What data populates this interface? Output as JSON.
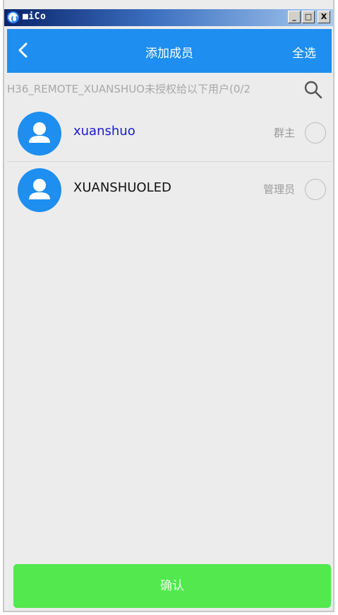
{
  "window": {
    "title": "■iCo",
    "minimize_label": "_",
    "maximize_label": "□",
    "close_label": "X"
  },
  "header": {
    "title": "添加成员",
    "select_all_label": "全选"
  },
  "subtitle": {
    "text": "H36_REMOTE_XUANSHUO未授权给以下用户(0/2"
  },
  "members": [
    {
      "name": "xuanshuo",
      "role": "群主",
      "name_color": "#1a1ad6"
    },
    {
      "name": "XUANSHUOLED",
      "role": "管理员",
      "name_color": "#111111"
    }
  ],
  "footer": {
    "confirm_label": "确认"
  },
  "colors": {
    "accent": "#1e8ef0",
    "confirm_green": "#52e84e"
  }
}
